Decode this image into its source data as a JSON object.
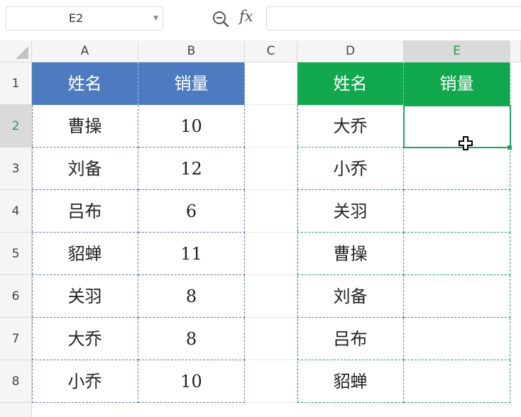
{
  "formula_bar": {
    "name_box": "E2",
    "fx_label": "fx",
    "formula_value": ""
  },
  "columns": [
    {
      "key": "A",
      "label": "A"
    },
    {
      "key": "B",
      "label": "B"
    },
    {
      "key": "C",
      "label": "C"
    },
    {
      "key": "D",
      "label": "D"
    },
    {
      "key": "E",
      "label": "E"
    }
  ],
  "rows": [
    "1",
    "2",
    "3",
    "4",
    "5",
    "6",
    "7",
    "8"
  ],
  "active_cell": {
    "col": "E",
    "row": "2"
  },
  "table_left": {
    "headers": [
      "姓名",
      "销量"
    ],
    "rows": [
      [
        "曹操",
        "10"
      ],
      [
        "刘备",
        "12"
      ],
      [
        "吕布",
        "6"
      ],
      [
        "貂蝉",
        "11"
      ],
      [
        "关羽",
        "8"
      ],
      [
        "大乔",
        "8"
      ],
      [
        "小乔",
        "10"
      ]
    ],
    "header_color": "#4e7bbf"
  },
  "table_right": {
    "headers": [
      "姓名",
      "销量"
    ],
    "rows": [
      [
        "大乔",
        ""
      ],
      [
        "小乔",
        ""
      ],
      [
        "关羽",
        ""
      ],
      [
        "曹操",
        ""
      ],
      [
        "刘备",
        ""
      ],
      [
        "吕布",
        ""
      ],
      [
        "貂蝉",
        ""
      ]
    ],
    "header_color": "#12a84e"
  },
  "icons": {
    "zoom": "zoom-formula-icon",
    "cursor": "cell-cross-cursor-icon",
    "dropdown": "chevron-down-icon"
  }
}
